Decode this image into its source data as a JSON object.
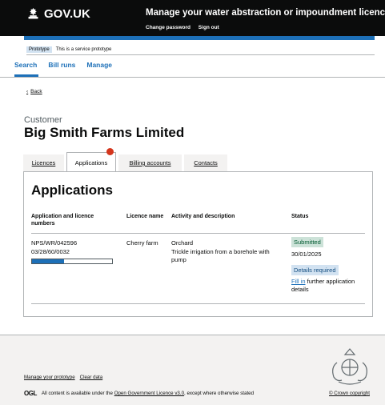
{
  "header": {
    "logo_text": "GOV.UK",
    "service_name": "Manage your water abstraction or impoundment licence",
    "nav": [
      "Change password",
      "Sign out"
    ]
  },
  "phase_banner": {
    "tag": "Prototype",
    "text": "This is a service prototype"
  },
  "primary_nav": {
    "items": [
      "Search",
      "Bill runs",
      "Manage"
    ],
    "active": "Search"
  },
  "back_link": "Back",
  "page": {
    "caption": "Customer",
    "title": "Big Smith Farms Limited"
  },
  "tabs": [
    "Licences",
    "Applications",
    "Billing accounts",
    "Contacts"
  ],
  "selected_tab": "Applications",
  "panel_title": "Applications",
  "table": {
    "headers": [
      "Application and licence numbers",
      "Licence name",
      "Activity and description",
      "Status"
    ],
    "rows": [
      {
        "application_number": "NPS/WR/042596",
        "licence_number": "03/28/60/0032",
        "progress_percent": 40,
        "licence_name": "Cherry farm",
        "activity": "Orchard",
        "description": "Trickle irrigation from a borehole with pump",
        "status_tag": "Submitted",
        "status_date": "30/01/2025",
        "action_tag": "Details required",
        "action_link": "Fill in",
        "action_text": "further application details"
      }
    ]
  },
  "footer": {
    "links": [
      "Manage your prototype",
      "Clear data"
    ],
    "ogl_label": "OGL",
    "licence_prefix": "All content is available under the",
    "licence_link": "Open Government Licence v3.0",
    "licence_suffix": ", except where otherwise stated",
    "copyright": "© Crown copyright"
  },
  "colors": {
    "header_bg": "#0b0c0c",
    "brand_blue": "#1d70b8",
    "notification_red": "#d4351c",
    "submitted_green": "#005a30",
    "footer_bg": "#f3f2f1"
  }
}
